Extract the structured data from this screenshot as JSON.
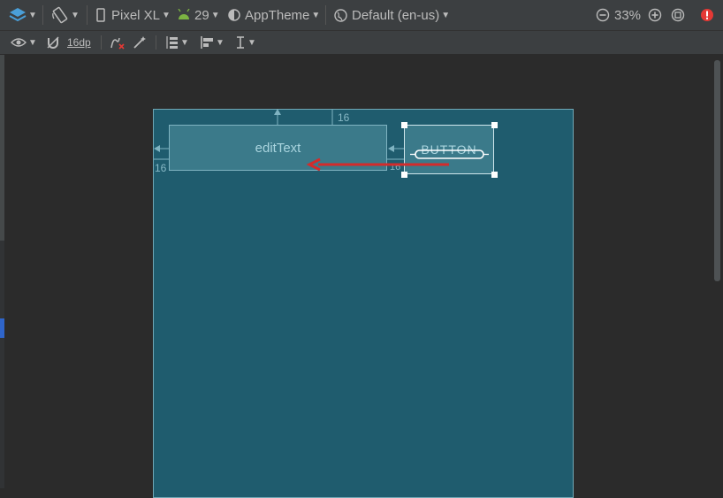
{
  "toolbar": {
    "device": "Pixel XL",
    "api_level": "29",
    "theme": "AppTheme",
    "locale": "Default (en-us)",
    "zoom": "33%",
    "default_margin": "16dp"
  },
  "canvas": {
    "edittext_label": "editText",
    "button_label": "BUTTON",
    "margin_top": "16",
    "margin_left": "16",
    "margin_between": "16"
  },
  "colors": {
    "blueprint_bg": "#1f5c6e",
    "widget_fill": "#3b7a8a",
    "arrow": "#d42b2b",
    "error": "#e53935"
  }
}
